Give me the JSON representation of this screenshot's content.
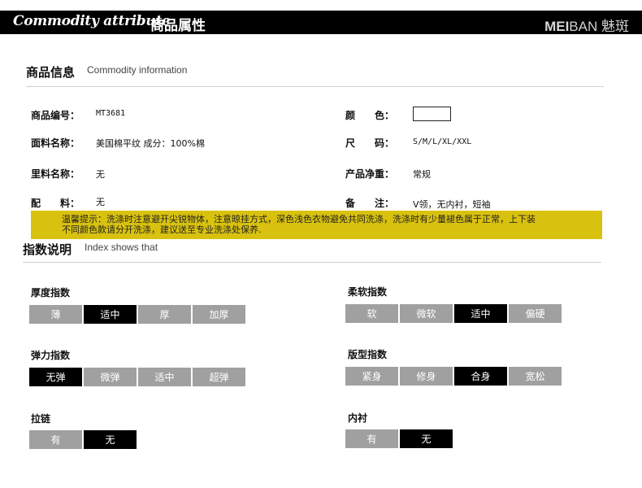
{
  "header": {
    "title_en": "Commodity attribute",
    "title_cn": "商品属性",
    "brand_bold": "MEI",
    "brand_rest": "BAN",
    "brand_cn": "魅斑"
  },
  "info": {
    "title": "商品信息",
    "subtitle": "Commodity information",
    "rows": [
      {
        "label": "商品编号：",
        "value": "MT3681"
      },
      {
        "label": "面料名称：",
        "value": "美国棉平纹 成分：100%棉"
      },
      {
        "label": "里料名称：",
        "value": "无"
      },
      {
        "label": "配　　料：",
        "value": "无"
      }
    ],
    "right_rows": [
      {
        "label": "颜　　色：",
        "value": ""
      },
      {
        "label": "尺　　码：",
        "value": "S/M/L/XL/XXL"
      },
      {
        "label": "产品净重：",
        "value": "常规"
      },
      {
        "label": "备　　注：",
        "value": "V领，无内衬，短袖"
      }
    ],
    "color_swatch": "#ffffff"
  },
  "notice": {
    "line1": "温馨提示：洗涤时注意避开尖锐物体，注意晾挂方式，深色浅色衣物避免共同洗涤，洗涤时有少量褪色属于正常，上下装",
    "line2": "不同颜色款请分开洗涤，建议送至专业洗涤处保养.",
    "color": "#d9c20f"
  },
  "index": {
    "title": "指数说明",
    "subtitle": "Index shows that",
    "groups": [
      {
        "title": "厚度指数",
        "options": [
          "薄",
          "适中",
          "厚",
          "加厚"
        ],
        "selected": "适中"
      },
      {
        "title": "柔软指数",
        "options": [
          "软",
          "微软",
          "适中",
          "偏硬"
        ],
        "selected": "适中"
      },
      {
        "title": "弹力指数",
        "options": [
          "无弹",
          "微弹",
          "适中",
          "超弹"
        ],
        "selected": "无弹"
      },
      {
        "title": "版型指数",
        "options": [
          "紧身",
          "修身",
          "合身",
          "宽松"
        ],
        "selected": "合身"
      },
      {
        "title": "拉链",
        "options": [
          "有",
          "无"
        ],
        "selected": "无"
      },
      {
        "title": "内衬",
        "options": [
          "有",
          "无"
        ],
        "selected": "无"
      }
    ]
  }
}
